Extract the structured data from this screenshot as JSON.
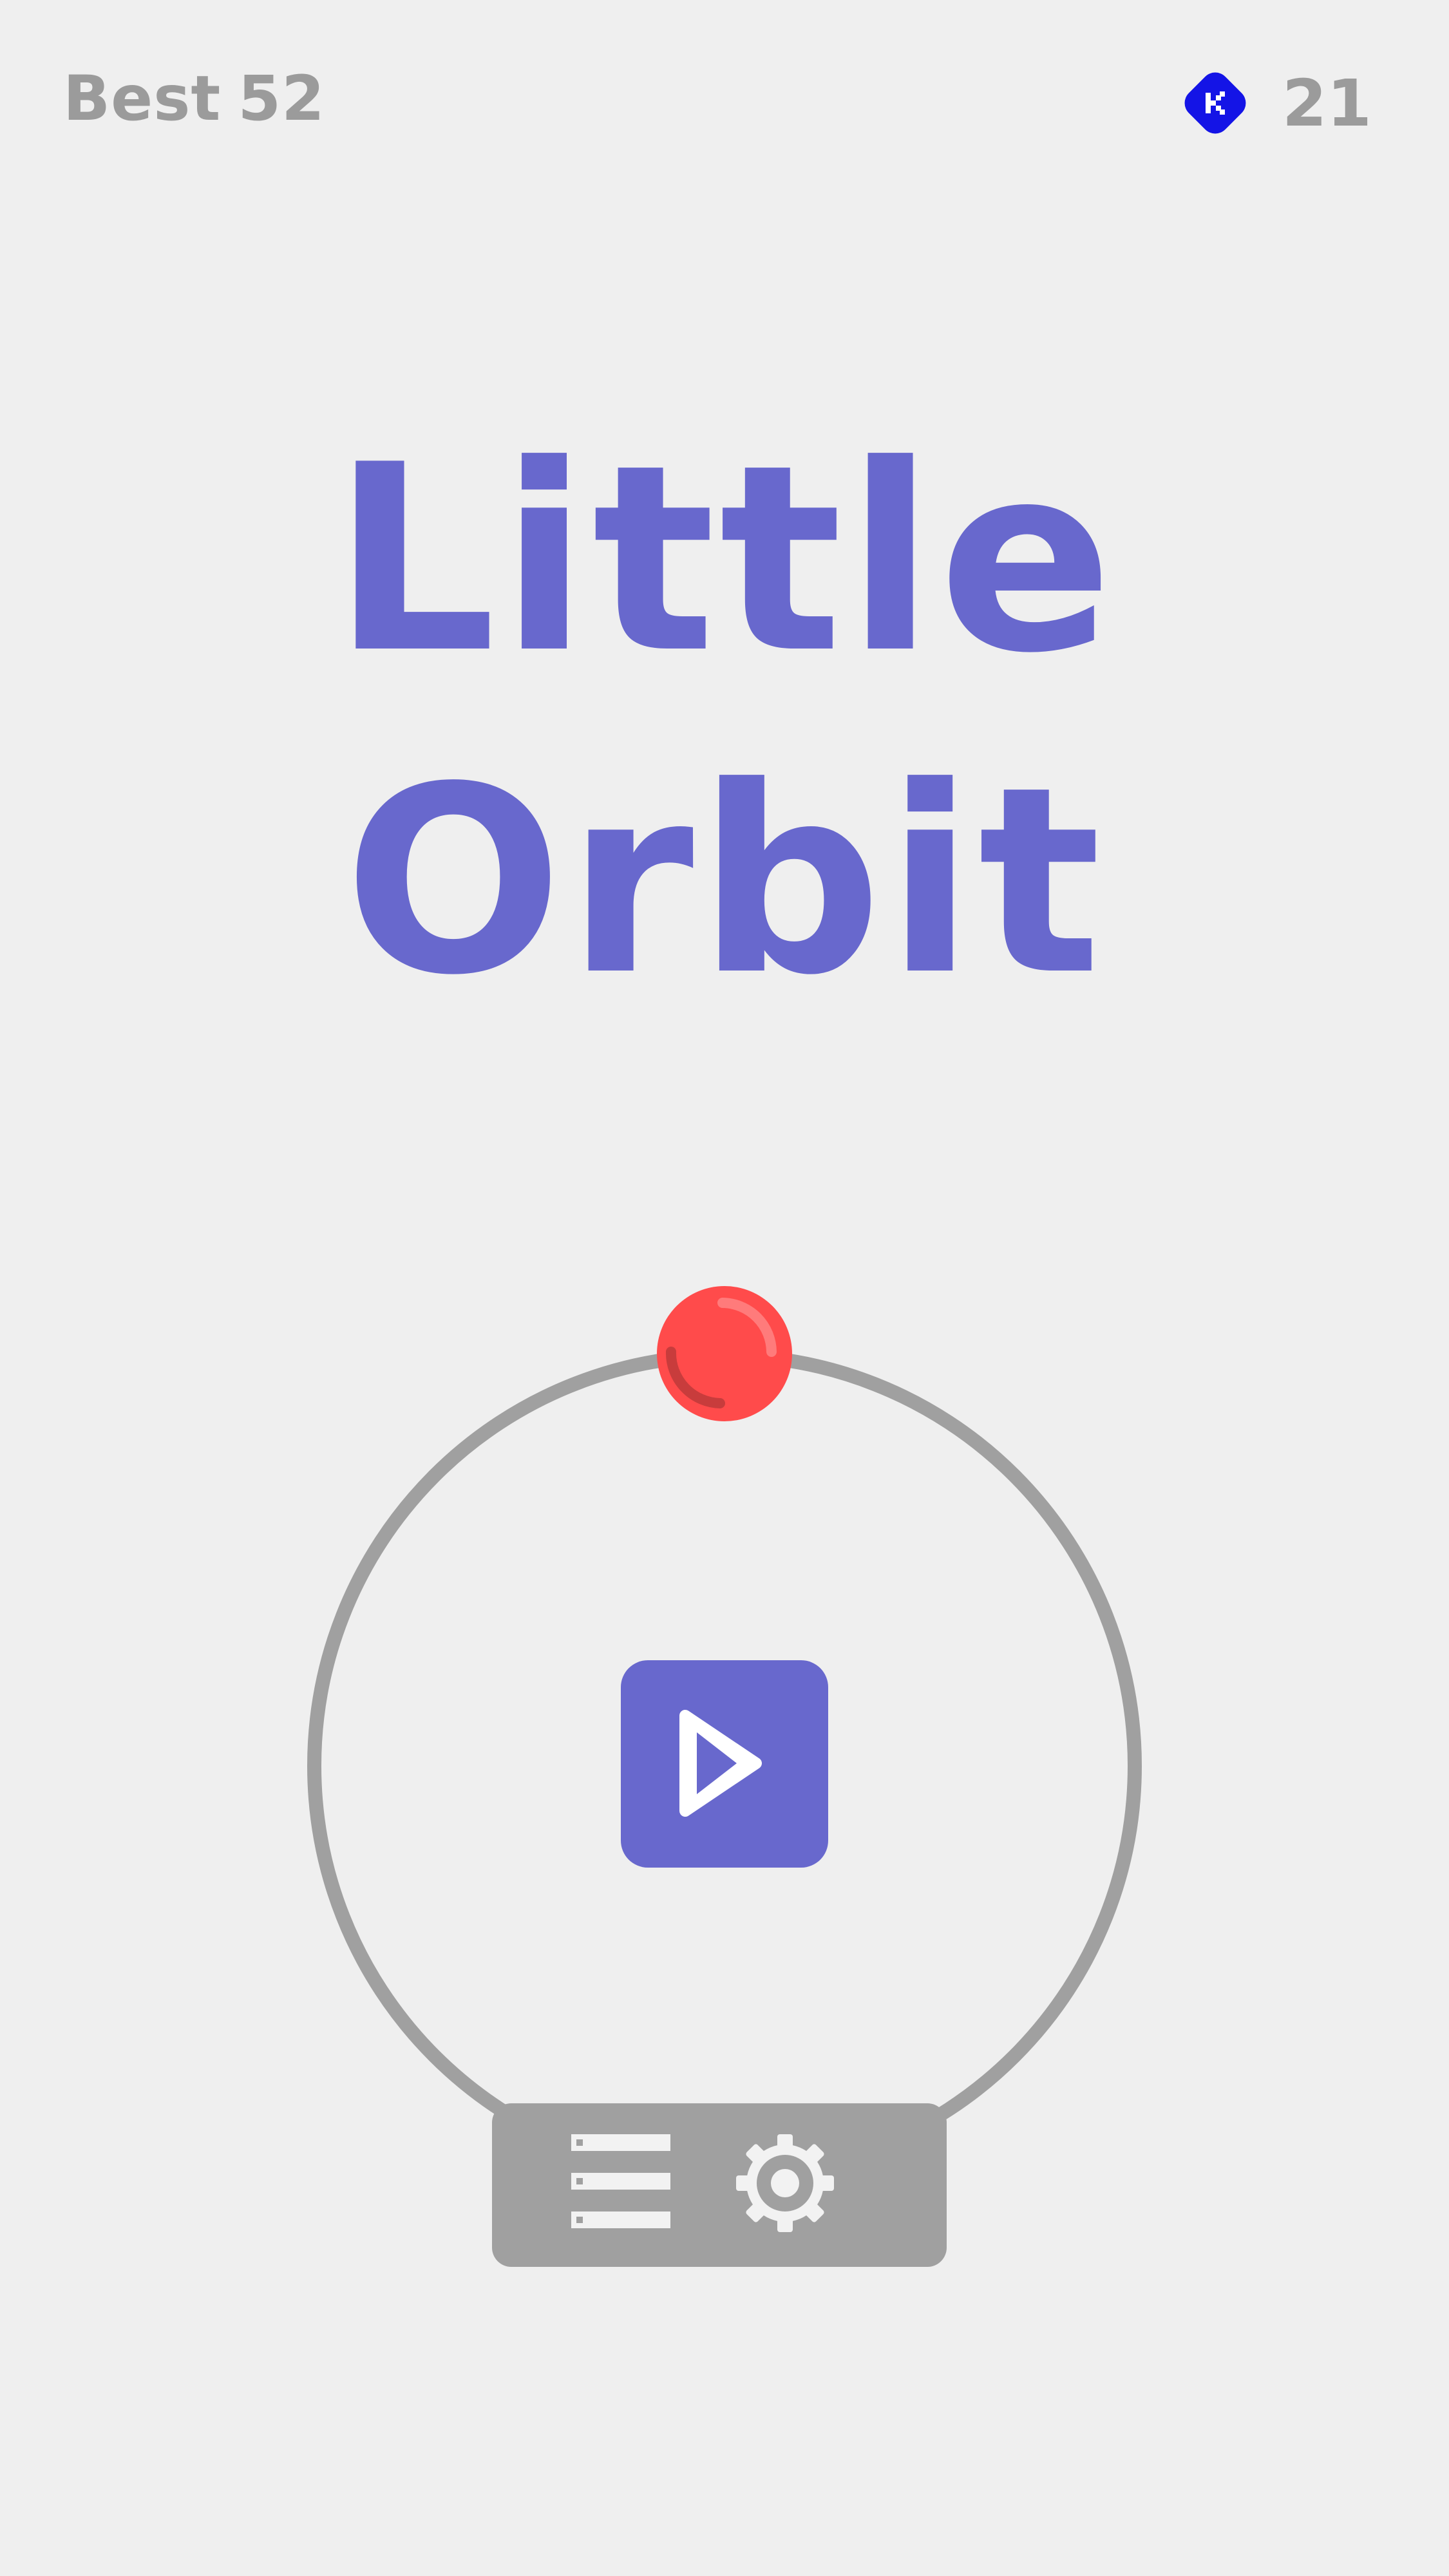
{
  "header": {
    "best_label": "Best",
    "best_value": "52",
    "gem_count": "21",
    "gem_icon": "gem-icon"
  },
  "title": {
    "line1": "Little",
    "line2": "Orbit"
  },
  "game": {
    "ball_icon": "red-ball",
    "play_icon": "play-icon"
  },
  "menu": {
    "left_icon": "list-icon",
    "right_icon": "gear-icon"
  },
  "colors": {
    "accent": "#6868cd",
    "ball": "#ff4b4b",
    "gem": "#1414e6",
    "muted": "#a0a0a0",
    "background": "#efefef"
  }
}
